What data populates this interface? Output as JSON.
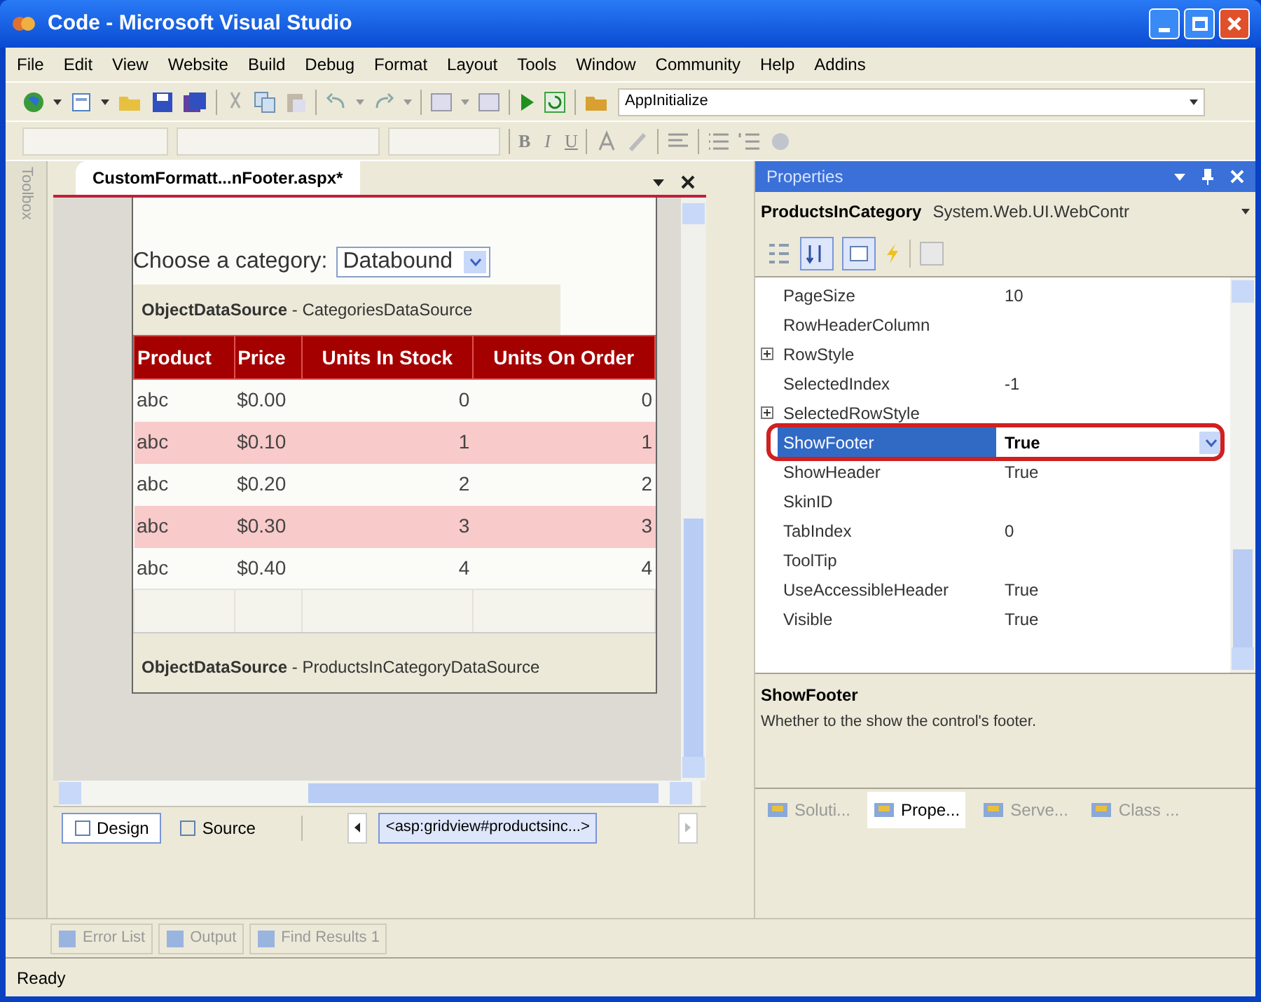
{
  "window": {
    "title": "Code - Microsoft Visual Studio"
  },
  "menu": [
    "File",
    "Edit",
    "View",
    "Website",
    "Build",
    "Debug",
    "Format",
    "Layout",
    "Tools",
    "Window",
    "Community",
    "Help",
    "Addins"
  ],
  "toolbar": {
    "startup_combo": "AppInitialize",
    "format_buttons": [
      "B",
      "I",
      "U"
    ]
  },
  "toolbox": {
    "label": "Toolbox"
  },
  "document": {
    "tab": "CustomFormatt...nFooter.aspx*",
    "category_label": "Choose a category:",
    "category_dropdown": "Databound",
    "categories_source": "**ObjectDataSource** - CategoriesDataSource",
    "grid": {
      "columns": [
        "Product",
        "Price",
        "Units In Stock",
        "Units On Order"
      ],
      "footer": true,
      "rows": [
        {
          "cells": [
            "abc",
            "$0.00",
            "0",
            "0"
          ],
          "alternate": false
        },
        {
          "cells": [
            "abc",
            "$0.10",
            "1",
            "1"
          ],
          "alternate": true
        },
        {
          "cells": [
            "abc",
            "$0.20",
            "2",
            "2"
          ],
          "alternate": false
        },
        {
          "cells": [
            "abc",
            "$0.30",
            "3",
            "3"
          ],
          "alternate": true
        },
        {
          "cells": [
            "abc",
            "$0.40",
            "4",
            "4"
          ],
          "alternate": false
        }
      ]
    },
    "products_source": "**ObjectDataSource** - ProductsInCategoryDataSource",
    "view_tabs": [
      {
        "label": "Design",
        "selected": true
      },
      {
        "label": "Source",
        "selected": false
      }
    ],
    "breadcrumb": "<asp:gridview#productsinc...>"
  },
  "properties": {
    "title": "Properties",
    "object_name": "ProductsInCategory",
    "object_type": "System.Web.UI.WebContr",
    "rows": [
      {
        "name": "PageSize",
        "value": "10",
        "selected": false
      },
      {
        "name": "RowHeaderColumn",
        "selected": false
      },
      {
        "name": "RowStyle",
        "expanded": false,
        "selected": false
      },
      {
        "name": "SelectedIndex",
        "value": "-1",
        "selected": false
      },
      {
        "name": "SelectedRowStyle",
        "expanded": false,
        "selected": false
      },
      {
        "name": "ShowFooter",
        "value": "True",
        "selected": true,
        "circled": true
      },
      {
        "name": "ShowHeader",
        "value": "True",
        "selected": false
      },
      {
        "name": "SkinID",
        "selected": false
      },
      {
        "name": "TabIndex",
        "value": "0",
        "selected": false
      },
      {
        "name": "ToolTip",
        "selected": false
      },
      {
        "name": "UseAccessibleHeader",
        "value": "True",
        "selected": false
      },
      {
        "name": "Visible",
        "value": "True",
        "selected": false
      }
    ],
    "description_title": "ShowFooter",
    "description": "Whether to the show the control's footer.",
    "tabs": [
      {
        "label": "Soluti...",
        "selected": false
      },
      {
        "label": "Prope...",
        "selected": true
      },
      {
        "label": "Serve...",
        "selected": false
      },
      {
        "label": "Class ...",
        "selected": false
      }
    ]
  },
  "tool_tabs": [
    "Error List",
    "Output",
    "Find Results 1"
  ],
  "status_bar": "Ready"
}
